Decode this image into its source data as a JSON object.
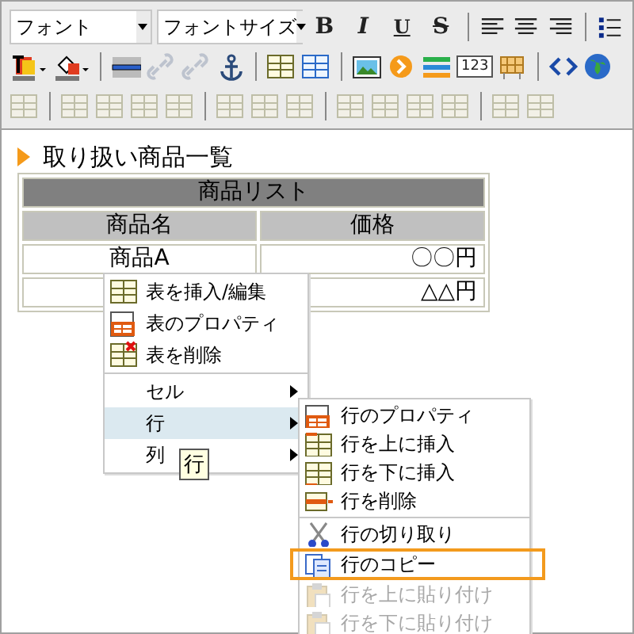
{
  "toolbar": {
    "rows": [
      [
        {
          "kind": "select",
          "placeholder": "フォント"
        },
        {
          "kind": "select",
          "placeholder": "フォントサイズ"
        },
        {
          "kind": "bold",
          "label": "B"
        },
        {
          "kind": "italic",
          "label": "I"
        },
        {
          "kind": "underline",
          "label": "U"
        },
        {
          "kind": "strike",
          "label": "S"
        },
        {
          "kind": "sep"
        },
        {
          "kind": "align-left"
        },
        {
          "kind": "align-center"
        },
        {
          "kind": "align-right"
        },
        {
          "kind": "sep"
        },
        {
          "kind": "list"
        }
      ],
      [
        {
          "kind": "text-color"
        },
        {
          "kind": "fill-color"
        },
        {
          "kind": "sep"
        },
        {
          "kind": "rule"
        },
        {
          "kind": "link",
          "disabled": true
        },
        {
          "kind": "link",
          "disabled": true
        },
        {
          "kind": "anchor"
        },
        {
          "kind": "sep"
        },
        {
          "kind": "table",
          "disabled": false
        },
        {
          "kind": "table-blue"
        },
        {
          "kind": "sep"
        },
        {
          "kind": "image"
        },
        {
          "kind": "orange-circle"
        },
        {
          "kind": "stripes"
        },
        {
          "kind": "number",
          "label": "123"
        },
        {
          "kind": "grid"
        },
        {
          "kind": "sep"
        },
        {
          "kind": "code"
        },
        {
          "kind": "globe"
        }
      ],
      [
        {
          "kind": "table",
          "disabled": true
        },
        {
          "kind": "sep"
        },
        {
          "kind": "table",
          "disabled": true
        },
        {
          "kind": "table",
          "disabled": true
        },
        {
          "kind": "table",
          "disabled": true
        },
        {
          "kind": "table",
          "disabled": true
        },
        {
          "kind": "sep"
        },
        {
          "kind": "table",
          "disabled": true
        },
        {
          "kind": "table",
          "disabled": true
        },
        {
          "kind": "table",
          "disabled": true
        },
        {
          "kind": "sep"
        },
        {
          "kind": "table",
          "disabled": true
        },
        {
          "kind": "table",
          "disabled": true
        },
        {
          "kind": "table",
          "disabled": true
        },
        {
          "kind": "table",
          "disabled": true
        },
        {
          "kind": "sep"
        },
        {
          "kind": "table",
          "disabled": true
        },
        {
          "kind": "table",
          "disabled": true
        }
      ]
    ]
  },
  "editor": {
    "heading": "取り扱い商品一覧",
    "table": {
      "caption": "商品リスト",
      "columns": [
        "商品名",
        "価格"
      ],
      "rows": [
        [
          "商品A",
          "〇〇円"
        ],
        [
          "",
          "△△円"
        ]
      ]
    }
  },
  "context_menu": {
    "items": [
      {
        "kind": "icon-item",
        "label": "表を挿入/編集",
        "selected": false
      },
      {
        "kind": "icon-item",
        "label": "表のプロパティ",
        "selected": false
      },
      {
        "kind": "icon-item",
        "label": "表を削除",
        "selected": false
      },
      {
        "kind": "sep"
      },
      {
        "kind": "submenu",
        "label": "セル",
        "selected": false
      },
      {
        "kind": "submenu",
        "label": "行",
        "selected": true
      },
      {
        "kind": "submenu",
        "label": "列",
        "selected": false
      }
    ]
  },
  "tooltip": "行",
  "submenu": {
    "items": [
      {
        "kind": "item",
        "label": "行のプロパティ",
        "disabled": false,
        "outlined": false
      },
      {
        "kind": "item",
        "label": "行を上に挿入",
        "disabled": false,
        "outlined": false
      },
      {
        "kind": "item",
        "label": "行を下に挿入",
        "disabled": false,
        "outlined": false
      },
      {
        "kind": "item",
        "label": "行を削除",
        "disabled": false,
        "outlined": false
      },
      {
        "kind": "sep"
      },
      {
        "kind": "item",
        "label": "行の切り取り",
        "disabled": false,
        "outlined": false
      },
      {
        "kind": "item",
        "label": "行のコピー",
        "disabled": false,
        "outlined": true
      },
      {
        "kind": "item",
        "label": "行を上に貼り付け",
        "disabled": true,
        "outlined": false
      },
      {
        "kind": "item",
        "label": "行を下に貼り付け",
        "disabled": true,
        "outlined": false
      }
    ]
  }
}
